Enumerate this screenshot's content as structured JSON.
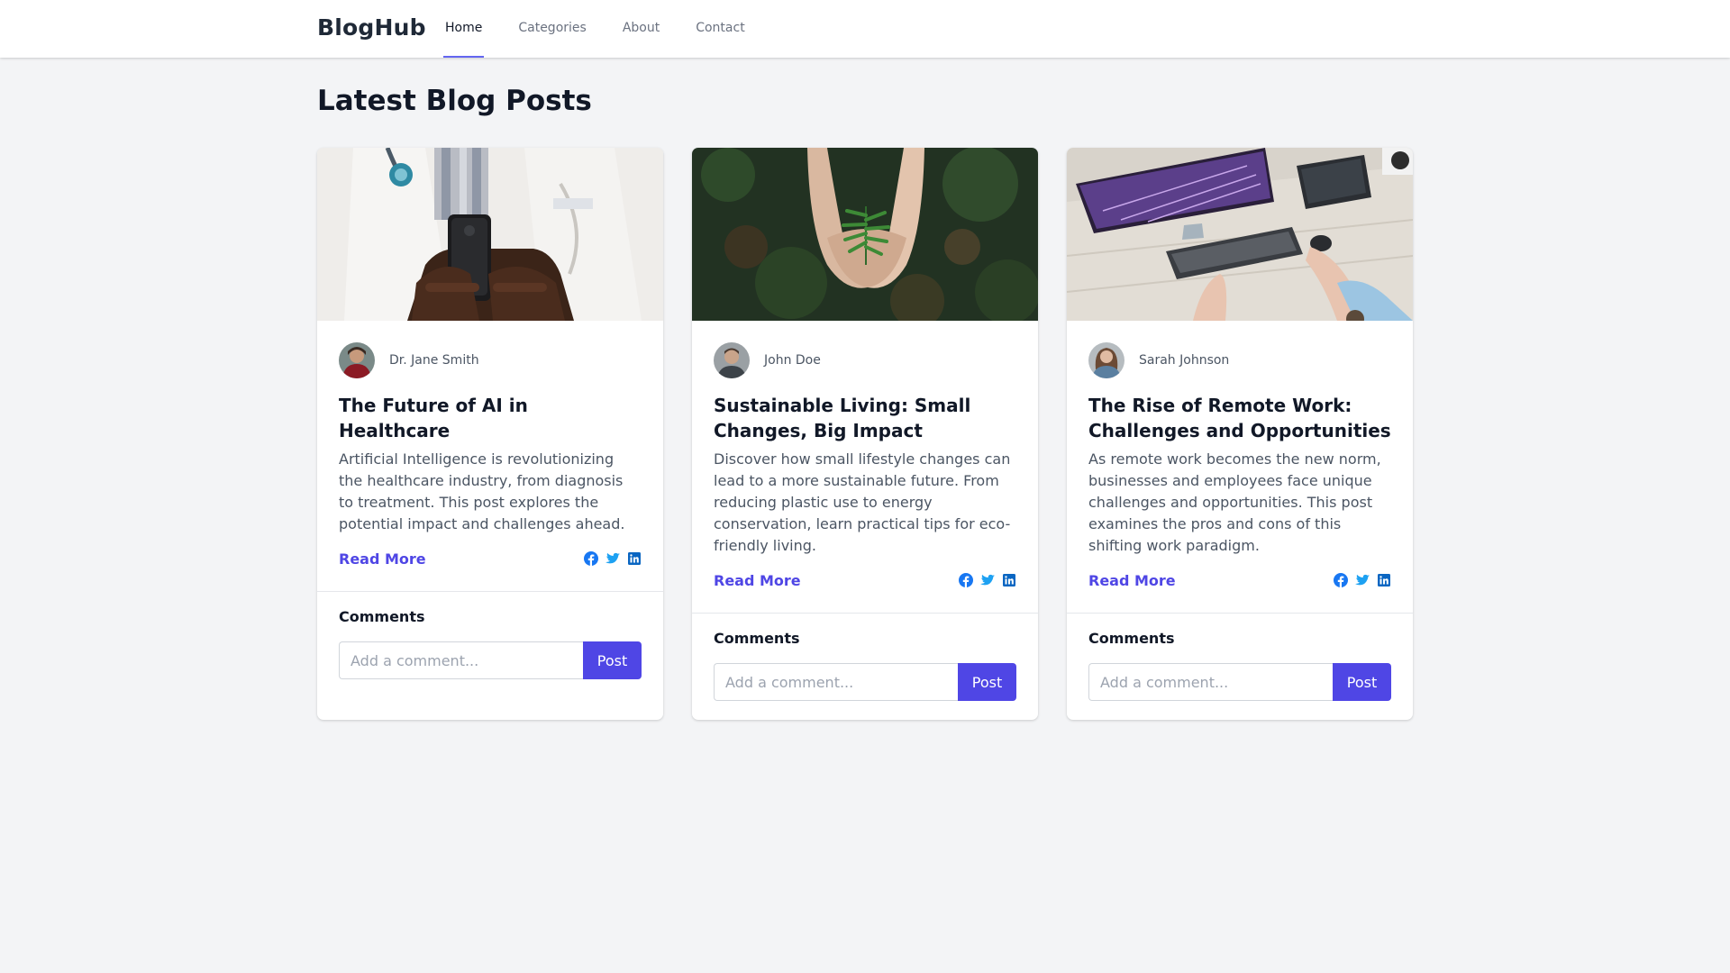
{
  "brand": "BlogHub",
  "nav": [
    {
      "label": "Home",
      "active": true
    },
    {
      "label": "Categories",
      "active": false
    },
    {
      "label": "About",
      "active": false
    },
    {
      "label": "Contact",
      "active": false
    }
  ],
  "page_title": "Latest Blog Posts",
  "posts": [
    {
      "author": "Dr. Jane Smith",
      "title": "The Future of AI in Healthcare",
      "excerpt": "Artificial Intelligence is revolutionizing the healthcare industry, from diagnosis to treatment. This post explores the potential impact and challenges ahead.",
      "read_more": "Read More",
      "comments_heading": "Comments",
      "comment_placeholder": "Add a comment...",
      "post_label": "Post"
    },
    {
      "author": "John Doe",
      "title": "Sustainable Living: Small Changes, Big Impact",
      "excerpt": "Discover how small lifestyle changes can lead to a more sustainable future. From reducing plastic use to energy conservation, learn practical tips for eco-friendly living.",
      "read_more": "Read More",
      "comments_heading": "Comments",
      "comment_placeholder": "Add a comment...",
      "post_label": "Post"
    },
    {
      "author": "Sarah Johnson",
      "title": "The Rise of Remote Work: Challenges and Opportunities",
      "excerpt": "As remote work becomes the new norm, businesses and employees face unique challenges and opportunities. This post examines the pros and cons of this shifting work paradigm.",
      "read_more": "Read More",
      "comments_heading": "Comments",
      "comment_placeholder": "Add a comment...",
      "post_label": "Post"
    }
  ],
  "colors": {
    "accent": "#4f46e5",
    "nav_underline": "#6366f1",
    "facebook": "#1877f2",
    "twitter": "#1da1f2",
    "linkedin": "#0a66c2"
  }
}
